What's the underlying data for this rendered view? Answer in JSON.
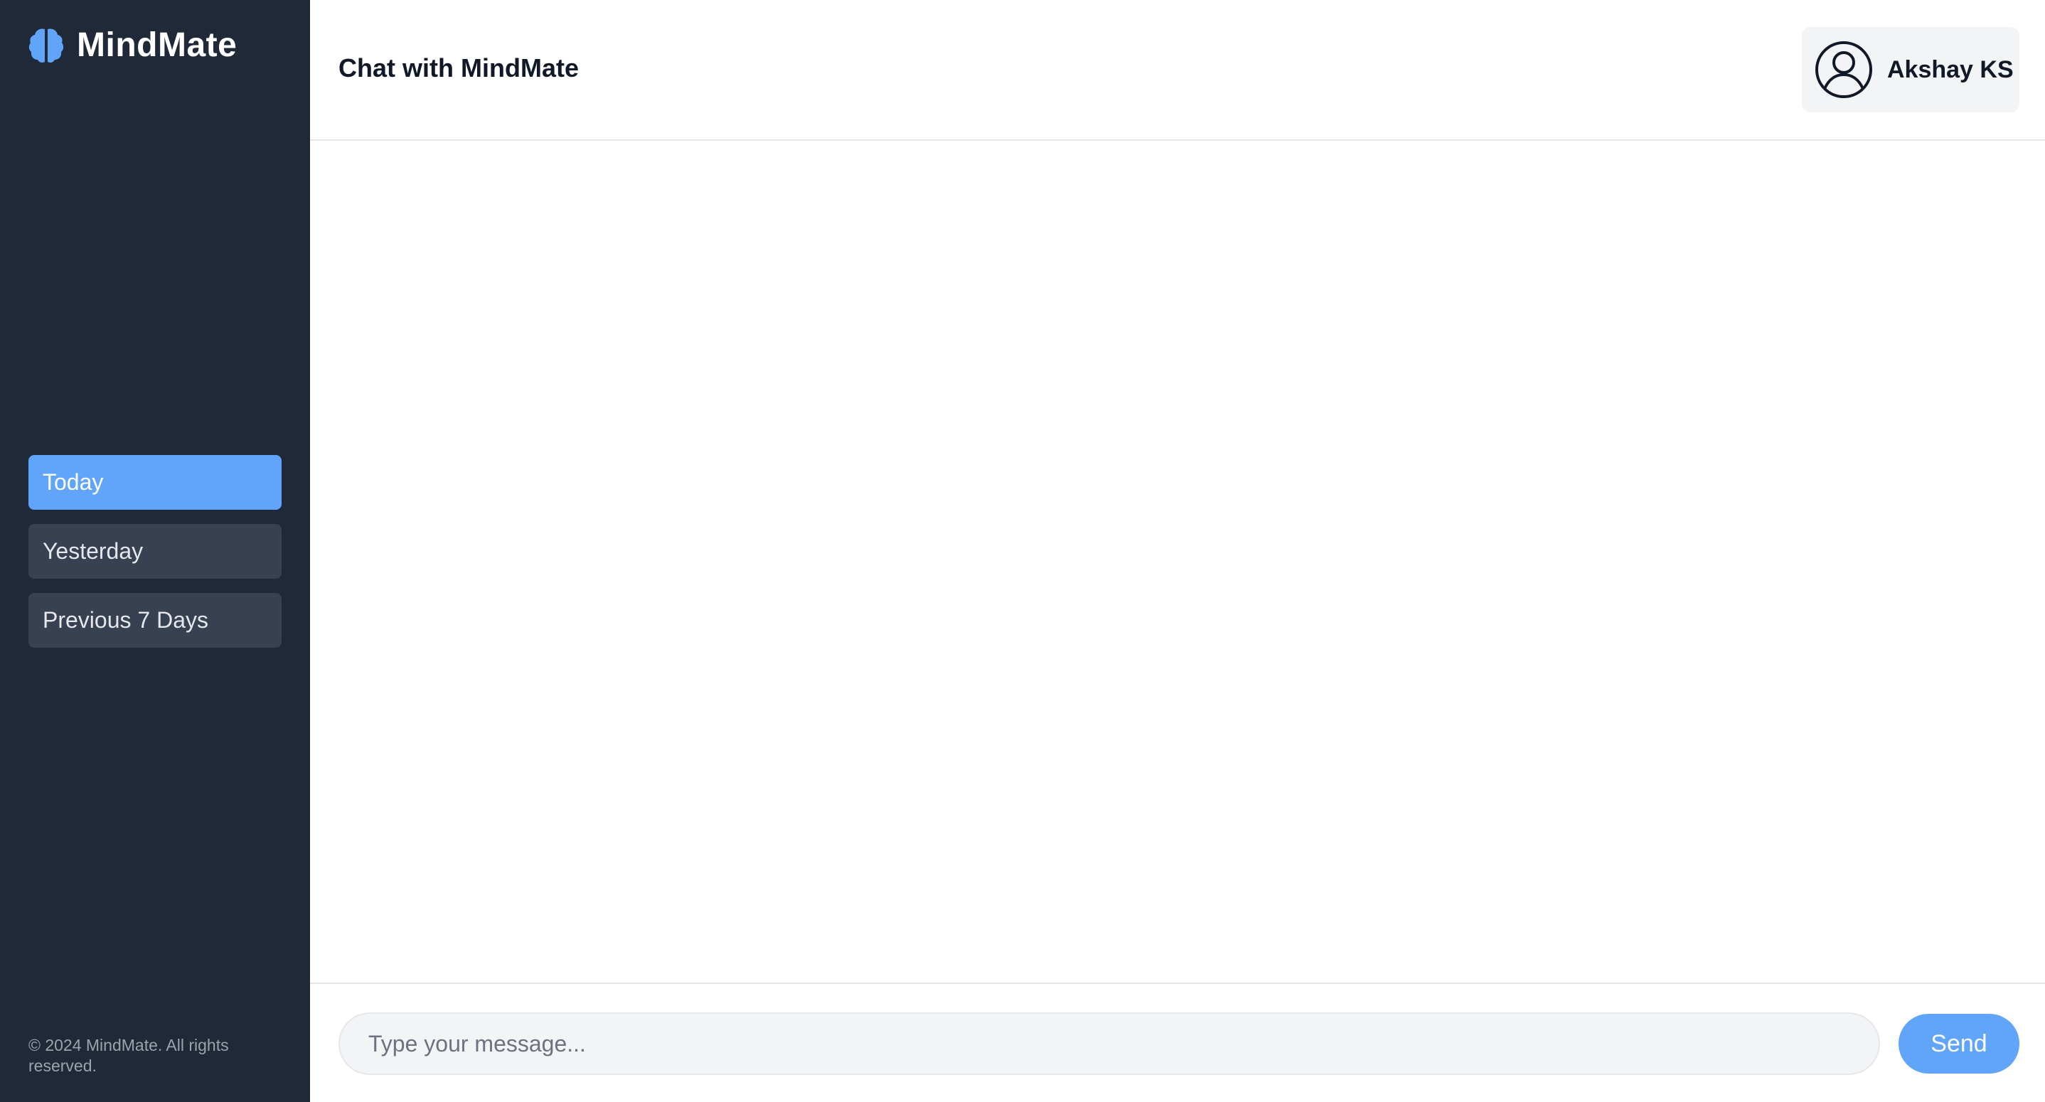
{
  "app": {
    "name": "MindMate",
    "logo_icon": "brain-icon",
    "accent_color": "#60a5fa",
    "sidebar_color": "#1f2937"
  },
  "sidebar": {
    "items": [
      {
        "label": "Today",
        "active": true
      },
      {
        "label": "Yesterday",
        "active": false
      },
      {
        "label": "Previous 7 Days",
        "active": false
      }
    ],
    "footer": "© 2024 MindMate. All rights reserved."
  },
  "header": {
    "title": "Chat with MindMate",
    "user": {
      "name": "Akshay KS",
      "avatar_icon": "user-circle-icon"
    }
  },
  "composer": {
    "placeholder": "Type your message...",
    "value": "",
    "send_label": "Send"
  }
}
